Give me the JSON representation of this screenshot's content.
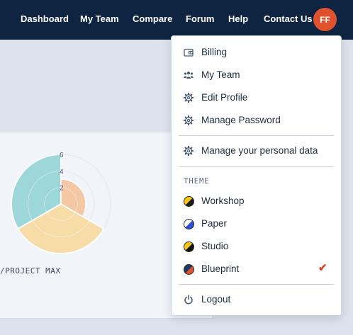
{
  "nav": {
    "links": [
      "Dashboard",
      "My Team",
      "Compare",
      "Forum",
      "Help",
      "Contact Us"
    ],
    "avatar_initials": "FF"
  },
  "chart_data": {
    "type": "radar",
    "title": "",
    "label": "/PROJECT MAX",
    "tick_labels": [
      "6",
      "4",
      "2"
    ],
    "rmax": 6,
    "series": [
      {
        "values": [
          6,
          6,
          6
        ]
      },
      {
        "values": [
          3,
          3,
          3
        ]
      }
    ],
    "colors": [
      "#f9d89a",
      "#8fd2d4",
      "#f5b98a"
    ]
  },
  "menu": {
    "items": [
      {
        "label": "Billing",
        "icon": "wallet-icon"
      },
      {
        "label": "My Team",
        "icon": "users-icon"
      },
      {
        "label": "Edit Profile",
        "icon": "gear-icon"
      },
      {
        "label": "Manage Password",
        "icon": "gear-icon"
      }
    ],
    "personal_data": {
      "label": "Manage your personal data",
      "icon": "gear-icon"
    },
    "theme_heading": "THEME",
    "themes": [
      {
        "label": "Workshop",
        "colors": [
          "#f5c518",
          "#1a1a1a"
        ],
        "selected": false
      },
      {
        "label": "Paper",
        "colors": [
          "#ffffff",
          "#2b4fd8"
        ],
        "selected": false
      },
      {
        "label": "Studio",
        "colors": [
          "#f5c518",
          "#111111"
        ],
        "selected": false
      },
      {
        "label": "Blueprint",
        "colors": [
          "#1f3b5c",
          "#e0522e"
        ],
        "selected": true
      }
    ],
    "logout": {
      "label": "Logout",
      "icon": "power-icon"
    },
    "check_glyph": "✔"
  }
}
